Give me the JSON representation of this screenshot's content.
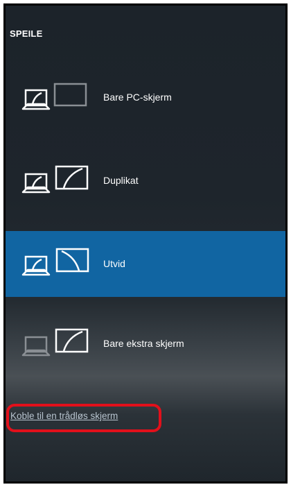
{
  "panel": {
    "title": "SPEILE"
  },
  "options": [
    {
      "label": "Bare PC-skjerm",
      "icon": "pc-screen-only-icon",
      "selected": false
    },
    {
      "label": "Duplikat",
      "icon": "duplicate-icon",
      "selected": false
    },
    {
      "label": "Utvid",
      "icon": "extend-icon",
      "selected": true
    },
    {
      "label": "Bare ekstra skjerm",
      "icon": "second-screen-only-icon",
      "selected": false
    }
  ],
  "wireless": {
    "link_label": "Koble til en trådløs skjerm"
  },
  "colors": {
    "selected_background": "#1165a2",
    "highlight_ring": "#e2101b",
    "link_text": "#b8c4cf"
  }
}
